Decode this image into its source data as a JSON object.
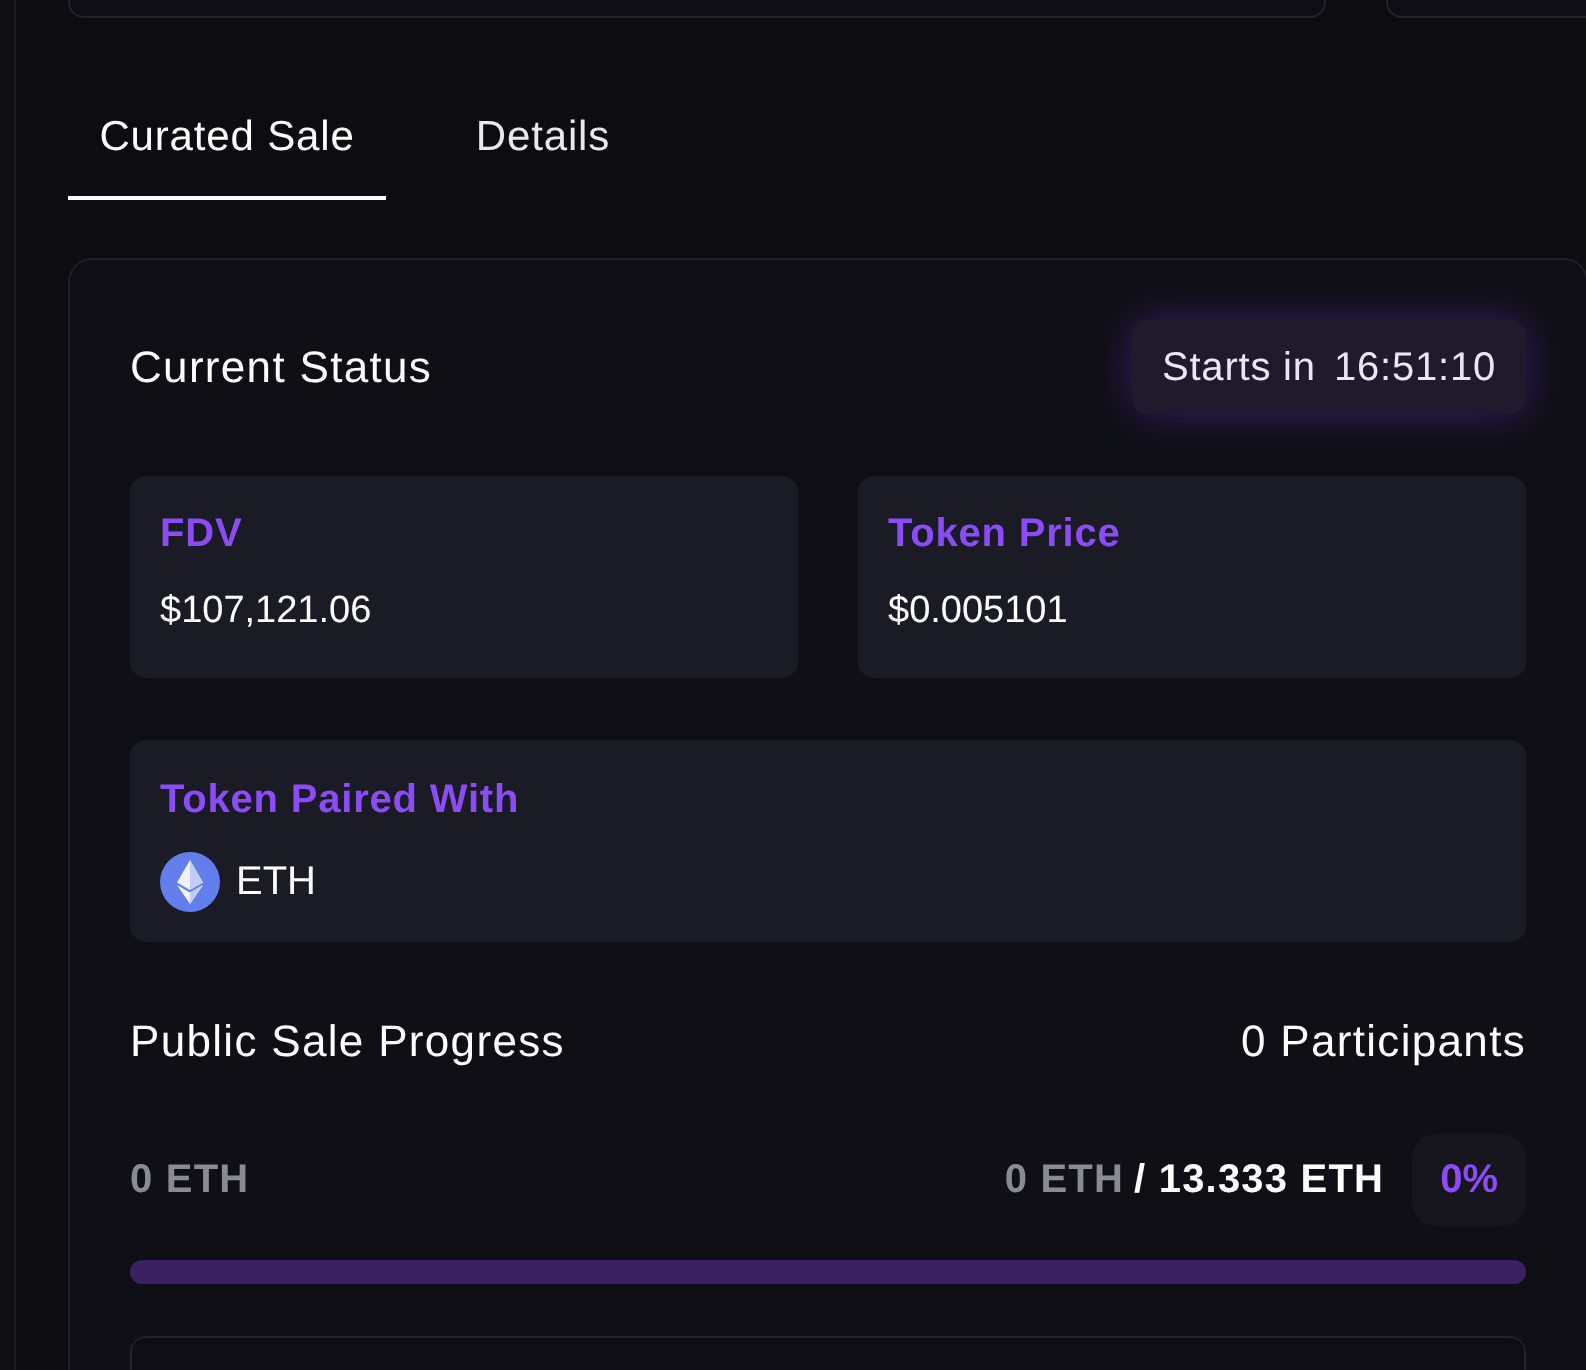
{
  "tabs": [
    {
      "label": "Curated Sale",
      "selected": true
    },
    {
      "label": "Details",
      "selected": false
    }
  ],
  "status": {
    "title": "Current Status",
    "countdown": {
      "label": "Starts in",
      "time": "16:51:10"
    }
  },
  "stats": [
    {
      "label": "FDV",
      "value": "$107,121.06"
    },
    {
      "label": "Token Price",
      "value": "$0.005101"
    }
  ],
  "paired": {
    "label": "Token Paired With",
    "token": "ETH"
  },
  "progress": {
    "title": "Public Sale Progress",
    "participants": "0 Participants",
    "raised": "0 ETH",
    "current": "0 ETH",
    "target": "/ 13.333 ETH",
    "percent": "0%"
  }
}
